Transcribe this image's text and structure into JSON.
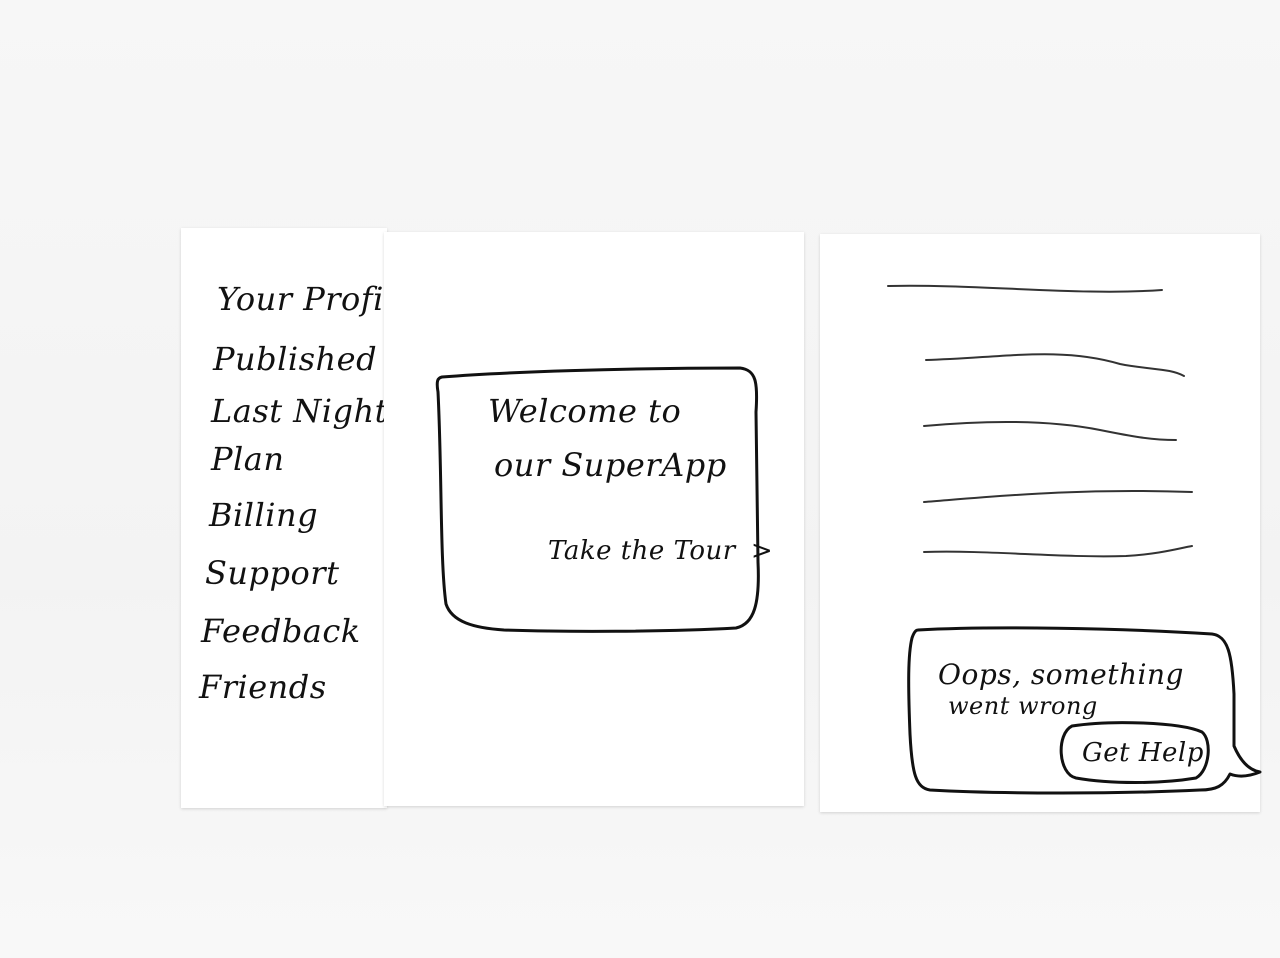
{
  "menu": {
    "items": [
      {
        "label": "Your Profile"
      },
      {
        "label": "Published"
      },
      {
        "label": "Last Night"
      },
      {
        "label": "Plan"
      },
      {
        "label": "Billing"
      },
      {
        "label": "Support"
      },
      {
        "label": "Feedback"
      },
      {
        "label": "Friends"
      }
    ]
  },
  "welcome": {
    "line1": "Welcome to",
    "line2": "our SuperApp",
    "tour_link": "Take the Tour",
    "tour_arrow": ">"
  },
  "error": {
    "line1": "Oops, something",
    "line2": "went wrong",
    "help_button": "Get Help"
  },
  "colors": {
    "ink": "#111111",
    "paper": "#ffffff",
    "background": "#f5f5f5"
  }
}
